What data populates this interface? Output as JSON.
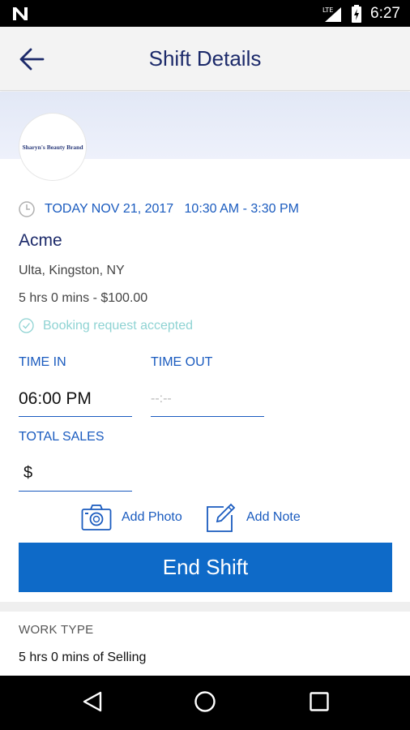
{
  "status_bar": {
    "network_label": "LTE",
    "time": "6:27"
  },
  "app_bar": {
    "title": "Shift Details",
    "back_icon": "arrow-back-icon"
  },
  "brand": {
    "logo_text": "Sharyn's Beauty Brand"
  },
  "shift": {
    "datetime": "TODAY NOV 21, 2017   10:30 AM - 3:30 PM",
    "company": "Acme",
    "location": "Ulta, Kingston, NY",
    "duration_pay": "5 hrs 0 mins - $100.00",
    "booking_status": "Booking request accepted"
  },
  "time_in": {
    "label": "TIME IN",
    "value": "06:00 PM"
  },
  "time_out": {
    "label": "TIME OUT",
    "placeholder": "--:--"
  },
  "total_sales": {
    "label": "TOTAL SALES",
    "currency": "$"
  },
  "actions": {
    "add_photo": "Add Photo",
    "add_note": "Add Note"
  },
  "end_shift_label": "End Shift",
  "work_type": {
    "label": "WORK TYPE",
    "value": "5 hrs 0 mins of Selling"
  },
  "colors": {
    "accent": "#0e6ac8",
    "link": "#1a5bbf",
    "title": "#1c2a6a",
    "success": "#8fd3d3"
  }
}
